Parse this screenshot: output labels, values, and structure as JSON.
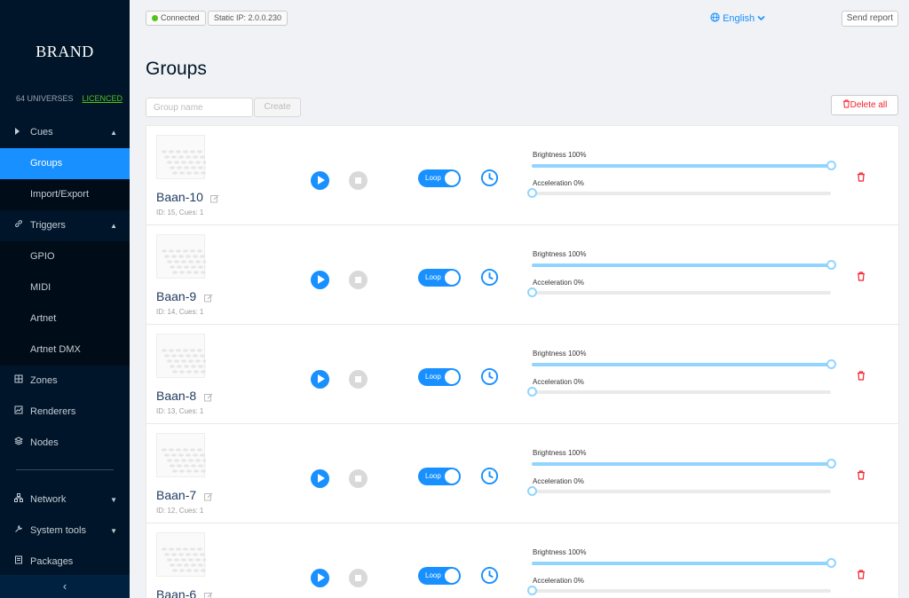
{
  "sidebar": {
    "brand": "BRAND",
    "universes": "64 UNIVERSES",
    "licence": "LICENCED",
    "items": [
      {
        "label": "Cues",
        "icon": "caret-right-icon",
        "chevron": "▲",
        "sub": false,
        "active": false
      },
      {
        "label": "Groups",
        "icon": "",
        "chevron": "",
        "sub": true,
        "active": true
      },
      {
        "label": "Import/Export",
        "icon": "",
        "chevron": "",
        "sub": true,
        "active": false
      },
      {
        "label": "Triggers",
        "icon": "link-icon",
        "chevron": "▲",
        "sub": false,
        "active": false
      },
      {
        "label": "GPIO",
        "icon": "",
        "chevron": "",
        "sub": true,
        "active": false
      },
      {
        "label": "MIDI",
        "icon": "",
        "chevron": "",
        "sub": true,
        "active": false
      },
      {
        "label": "Artnet",
        "icon": "",
        "chevron": "",
        "sub": true,
        "active": false
      },
      {
        "label": "Artnet DMX",
        "icon": "",
        "chevron": "",
        "sub": true,
        "active": false
      },
      {
        "label": "Zones",
        "icon": "grid-icon",
        "chevron": "",
        "sub": false,
        "active": false
      },
      {
        "label": "Renderers",
        "icon": "line-chart-icon",
        "chevron": "",
        "sub": false,
        "active": false
      },
      {
        "label": "Nodes",
        "icon": "cluster-icon",
        "chevron": "",
        "sub": false,
        "active": false
      }
    ],
    "lower_items": [
      {
        "label": "Network",
        "icon": "network-icon",
        "chevron": "▼"
      },
      {
        "label": "System tools",
        "icon": "wrench-icon",
        "chevron": "▼"
      },
      {
        "label": "Packages",
        "icon": "package-icon",
        "chevron": ""
      }
    ],
    "collapse_glyph": "‹"
  },
  "header": {
    "status": "Connected",
    "static_ip": "Static IP: 2.0.0.230",
    "language": "English",
    "send_report": "Send report"
  },
  "page": {
    "title": "Groups",
    "group_name_placeholder": "Group name",
    "create_label": "Create",
    "delete_all_label": "Delete all"
  },
  "groups": [
    {
      "name": "Baan-10",
      "meta": "ID: 15, Cues: 1",
      "loop_label": "Loop",
      "brightness_label": "Brightness 100%",
      "brightness": 100,
      "acceleration_label": "Acceleration 0%",
      "acceleration": 0
    },
    {
      "name": "Baan-9",
      "meta": "ID: 14, Cues: 1",
      "loop_label": "Loop",
      "brightness_label": "Brightness 100%",
      "brightness": 100,
      "acceleration_label": "Acceleration 0%",
      "acceleration": 0
    },
    {
      "name": "Baan-8",
      "meta": "ID: 13, Cues: 1",
      "loop_label": "Loop",
      "brightness_label": "Brightness 100%",
      "brightness": 100,
      "acceleration_label": "Acceleration 0%",
      "acceleration": 0
    },
    {
      "name": "Baan-7",
      "meta": "ID: 12, Cues: 1",
      "loop_label": "Loop",
      "brightness_label": "Brightness 100%",
      "brightness": 100,
      "acceleration_label": "Acceleration 0%",
      "acceleration": 0
    },
    {
      "name": "Baan-6",
      "meta": "",
      "loop_label": "Loop",
      "brightness_label": "Brightness 100%",
      "brightness": 100,
      "acceleration_label": "Acceleration 0%",
      "acceleration": 0
    }
  ],
  "colors": {
    "accent": "#1890ff",
    "sidebar_bg": "#001529",
    "danger": "#f5222d",
    "success": "#52c41a"
  }
}
